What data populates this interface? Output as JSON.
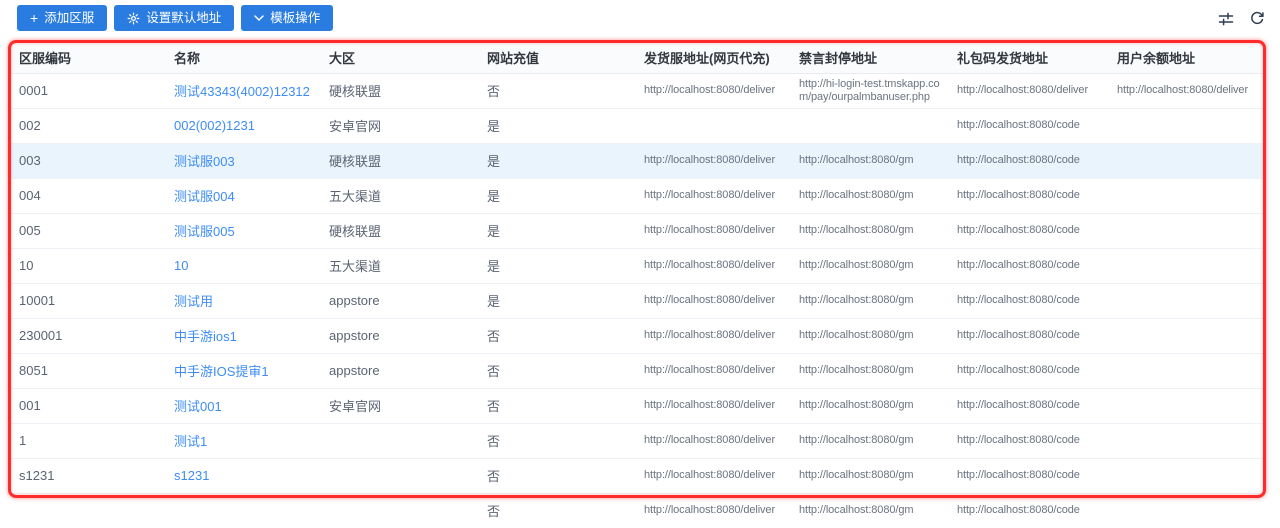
{
  "toolbar": {
    "add_button": "添加区服",
    "set_default_button": "设置默认地址",
    "template_button": "模板操作"
  },
  "colors": {
    "primary_button": "#2a7ce0",
    "link": "#3d8df5",
    "highlighted_row_bg": "#e9f4fd",
    "annotation_border": "#ff2b2b"
  },
  "table": {
    "columns": [
      "区服编码",
      "名称",
      "大区",
      "网站充值",
      "发货服地址(网页代充)",
      "禁言封停地址",
      "礼包码发货地址",
      "用户余额地址"
    ],
    "rows": [
      {
        "code": "0001",
        "name": "测试43343(4002)12312",
        "region": "硬核联盟",
        "web_recharge": "否",
        "deliver_url": "http://localhost:8080/deliver",
        "ban_url": "http://hi-login-test.tmskapp.com/pay/ourpalmbanuser.php",
        "gift_url": "http://localhost:8080/deliver",
        "balance_url": "http://localhost:8080/deliver",
        "highlighted": false
      },
      {
        "code": "002",
        "name": "002(002)1231",
        "region": "安卓官网",
        "web_recharge": "是",
        "deliver_url": "",
        "ban_url": "",
        "gift_url": "http://localhost:8080/code",
        "balance_url": "",
        "highlighted": false
      },
      {
        "code": "003",
        "name": "测试服003",
        "region": "硬核联盟",
        "web_recharge": "是",
        "deliver_url": "http://localhost:8080/deliver",
        "ban_url": "http://localhost:8080/gm",
        "gift_url": "http://localhost:8080/code",
        "balance_url": "",
        "highlighted": true
      },
      {
        "code": "004",
        "name": "测试服004",
        "region": "五大渠道",
        "web_recharge": "是",
        "deliver_url": "http://localhost:8080/deliver",
        "ban_url": "http://localhost:8080/gm",
        "gift_url": "http://localhost:8080/code",
        "balance_url": "",
        "highlighted": false
      },
      {
        "code": "005",
        "name": "测试服005",
        "region": "硬核联盟",
        "web_recharge": "是",
        "deliver_url": "http://localhost:8080/deliver",
        "ban_url": "http://localhost:8080/gm",
        "gift_url": "http://localhost:8080/code",
        "balance_url": "",
        "highlighted": false
      },
      {
        "code": "10",
        "name": "10",
        "region": "五大渠道",
        "web_recharge": "是",
        "deliver_url": "http://localhost:8080/deliver",
        "ban_url": "http://localhost:8080/gm",
        "gift_url": "http://localhost:8080/code",
        "balance_url": "",
        "highlighted": false
      },
      {
        "code": "10001",
        "name": "测试用",
        "region": "appstore",
        "web_recharge": "是",
        "deliver_url": "http://localhost:8080/deliver",
        "ban_url": "http://localhost:8080/gm",
        "gift_url": "http://localhost:8080/code",
        "balance_url": "",
        "highlighted": false
      },
      {
        "code": "230001",
        "name": "中手游ios1",
        "region": "appstore",
        "web_recharge": "否",
        "deliver_url": "http://localhost:8080/deliver",
        "ban_url": "http://localhost:8080/gm",
        "gift_url": "http://localhost:8080/code",
        "balance_url": "",
        "highlighted": false
      },
      {
        "code": "8051",
        "name": "中手游IOS提审1",
        "region": "appstore",
        "web_recharge": "否",
        "deliver_url": "http://localhost:8080/deliver",
        "ban_url": "http://localhost:8080/gm",
        "gift_url": "http://localhost:8080/code",
        "balance_url": "",
        "highlighted": false
      },
      {
        "code": "001",
        "name": "测试001",
        "region": "安卓官网",
        "web_recharge": "否",
        "deliver_url": "http://localhost:8080/deliver",
        "ban_url": "http://localhost:8080/gm",
        "gift_url": "http://localhost:8080/code",
        "balance_url": "",
        "highlighted": false
      },
      {
        "code": "1",
        "name": "测试1",
        "region": "",
        "web_recharge": "否",
        "deliver_url": "http://localhost:8080/deliver",
        "ban_url": "http://localhost:8080/gm",
        "gift_url": "http://localhost:8080/code",
        "balance_url": "",
        "highlighted": false
      },
      {
        "code": "s1231",
        "name": "s1231",
        "region": "",
        "web_recharge": "否",
        "deliver_url": "http://localhost:8080/deliver",
        "ban_url": "http://localhost:8080/gm",
        "gift_url": "http://localhost:8080/code",
        "balance_url": "",
        "highlighted": false
      }
    ],
    "partial_row": {
      "code": "",
      "name": "",
      "region": "",
      "web_recharge": "否",
      "deliver_url": "http://localhost:8080/deliver",
      "ban_url": "http://localhost:8080/gm",
      "gift_url": "http://localhost:8080/code",
      "balance_url": "",
      "highlighted": false
    }
  }
}
